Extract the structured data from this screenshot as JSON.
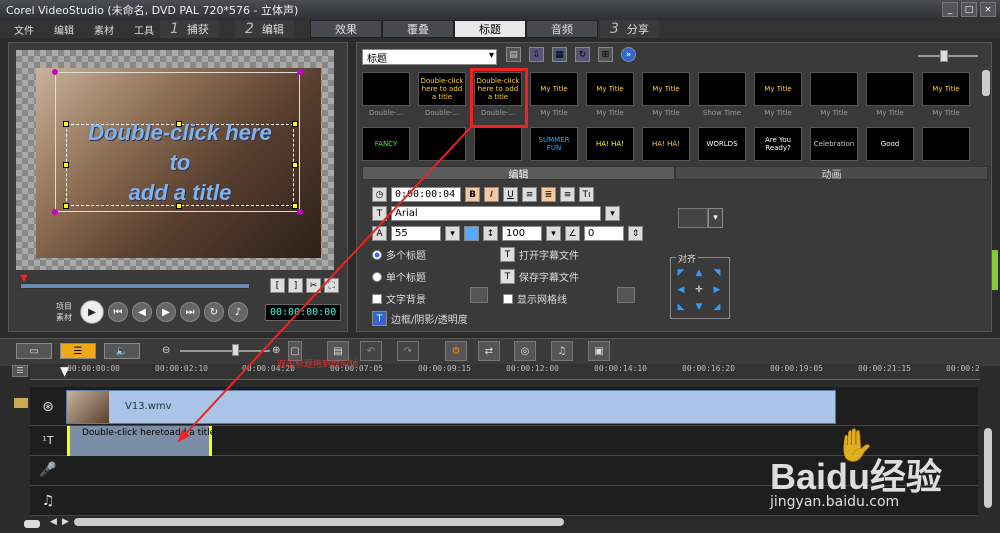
{
  "window": {
    "title": "Corel VideoStudio (未命名, DVD PAL 720*576 - 立体声)",
    "min": "_",
    "max": "□",
    "close": "×"
  },
  "menu": [
    "文件",
    "编辑",
    "素材",
    "工具"
  ],
  "steps": [
    {
      "num": "1",
      "label": "捕获"
    },
    {
      "num": "2",
      "label": "编辑"
    },
    {
      "num": "3",
      "label": "分享"
    }
  ],
  "tabs": [
    {
      "label": "效果",
      "active": false
    },
    {
      "label": "覆叠",
      "active": false
    },
    {
      "label": "标题",
      "active": true
    },
    {
      "label": "音频",
      "active": false
    }
  ],
  "preview": {
    "overlay_lines": [
      "Double-click here",
      "to",
      "add a title"
    ],
    "play_labels": [
      "项目",
      "素材"
    ],
    "timecode": "00:00:00:00"
  },
  "library": {
    "selected": "标题",
    "row1": [
      "Double-...",
      "Double-...",
      "Double-...",
      "My Title",
      "My Title",
      "My Title",
      "Show Time",
      "My Title",
      "My Title",
      "My Title",
      "My Title"
    ],
    "row1_text": [
      "",
      "Double-click here to add a title",
      "Double-click here to add a title",
      "My Title",
      "My Title",
      "My Title",
      "",
      "My Title",
      "",
      "",
      "My Title"
    ],
    "row2_text": [
      "FANCY",
      "",
      "",
      "SUMMER FUN",
      "HA! HA!",
      "HA! HA!",
      "WORLDS",
      "Are You Ready?",
      "Celebration",
      "Good",
      ""
    ]
  },
  "edit": {
    "tab_edit": "编辑",
    "tab_anim": "动画",
    "duration": "0:00:00:04",
    "bold": "B",
    "italic": "I",
    "underline": "U",
    "font": "Arial",
    "size": "55",
    "leading": "100",
    "angle": "0",
    "multi_title": "多个标题",
    "single_title": "单个标题",
    "open_subtitle": "打开字幕文件",
    "save_subtitle": "保存字幕文件",
    "text_bg": "文字背景",
    "show_grid": "显示网格线",
    "border_shadow": "边框/阴影/透明度",
    "align_label": "对齐"
  },
  "timeline": {
    "ticks": [
      "00:00:00:00",
      "00:00:02:10",
      "00:00:04:20",
      "00:00:07:05",
      "00:00:09:15",
      "00:00:12:00",
      "00:00:14:10",
      "00:00:16:20",
      "00:00:19:05",
      "00:00:21:15",
      "00:00:2"
    ],
    "video_clip": "V13.wmv",
    "title_clip": "Double-click heretoadd a title",
    "annotation": "双击标题拖到时间轴"
  },
  "watermark": {
    "brand": "Baidu经验",
    "url": "jingyan.baidu.com"
  },
  "colors": {
    "accent": "#f0a818",
    "highlight": "#e22"
  }
}
